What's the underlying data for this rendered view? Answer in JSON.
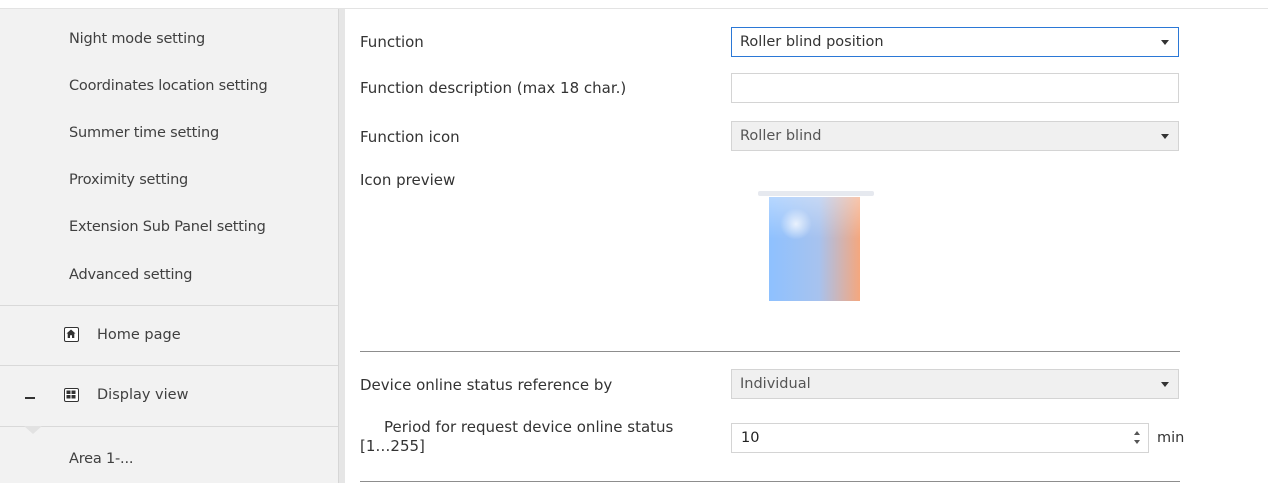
{
  "sidebar": {
    "items": [
      {
        "label": "Night mode setting"
      },
      {
        "label": "Coordinates location setting"
      },
      {
        "label": "Summer time setting"
      },
      {
        "label": "Proximity setting"
      },
      {
        "label": "Extension Sub Panel setting"
      },
      {
        "label": "Advanced setting"
      }
    ],
    "home": {
      "label": "Home page",
      "icon": "home-icon"
    },
    "display": {
      "label": "Display view",
      "icon": "grid-icon",
      "expander": "collapse-icon"
    },
    "area": {
      "label": "Area 1-..."
    }
  },
  "form": {
    "function": {
      "label": "Function",
      "value": "Roller blind position"
    },
    "description": {
      "label": "Function description (max 18 char.)",
      "value": ""
    },
    "icon": {
      "label": "Function icon",
      "value": "Roller blind"
    },
    "preview": {
      "label": "Icon preview",
      "icon": "roller-blind-icon"
    },
    "online_status": {
      "label": "Device online status reference by",
      "value": "Individual"
    },
    "period": {
      "label_line1": "Period for request device online status",
      "label_line2": "[1…255]",
      "value": "10",
      "unit": "min"
    }
  },
  "colors": {
    "sidebar_bg": "#f2f2f2",
    "accent_border": "#2b78d6",
    "select_bg": "#f0f0f0"
  }
}
